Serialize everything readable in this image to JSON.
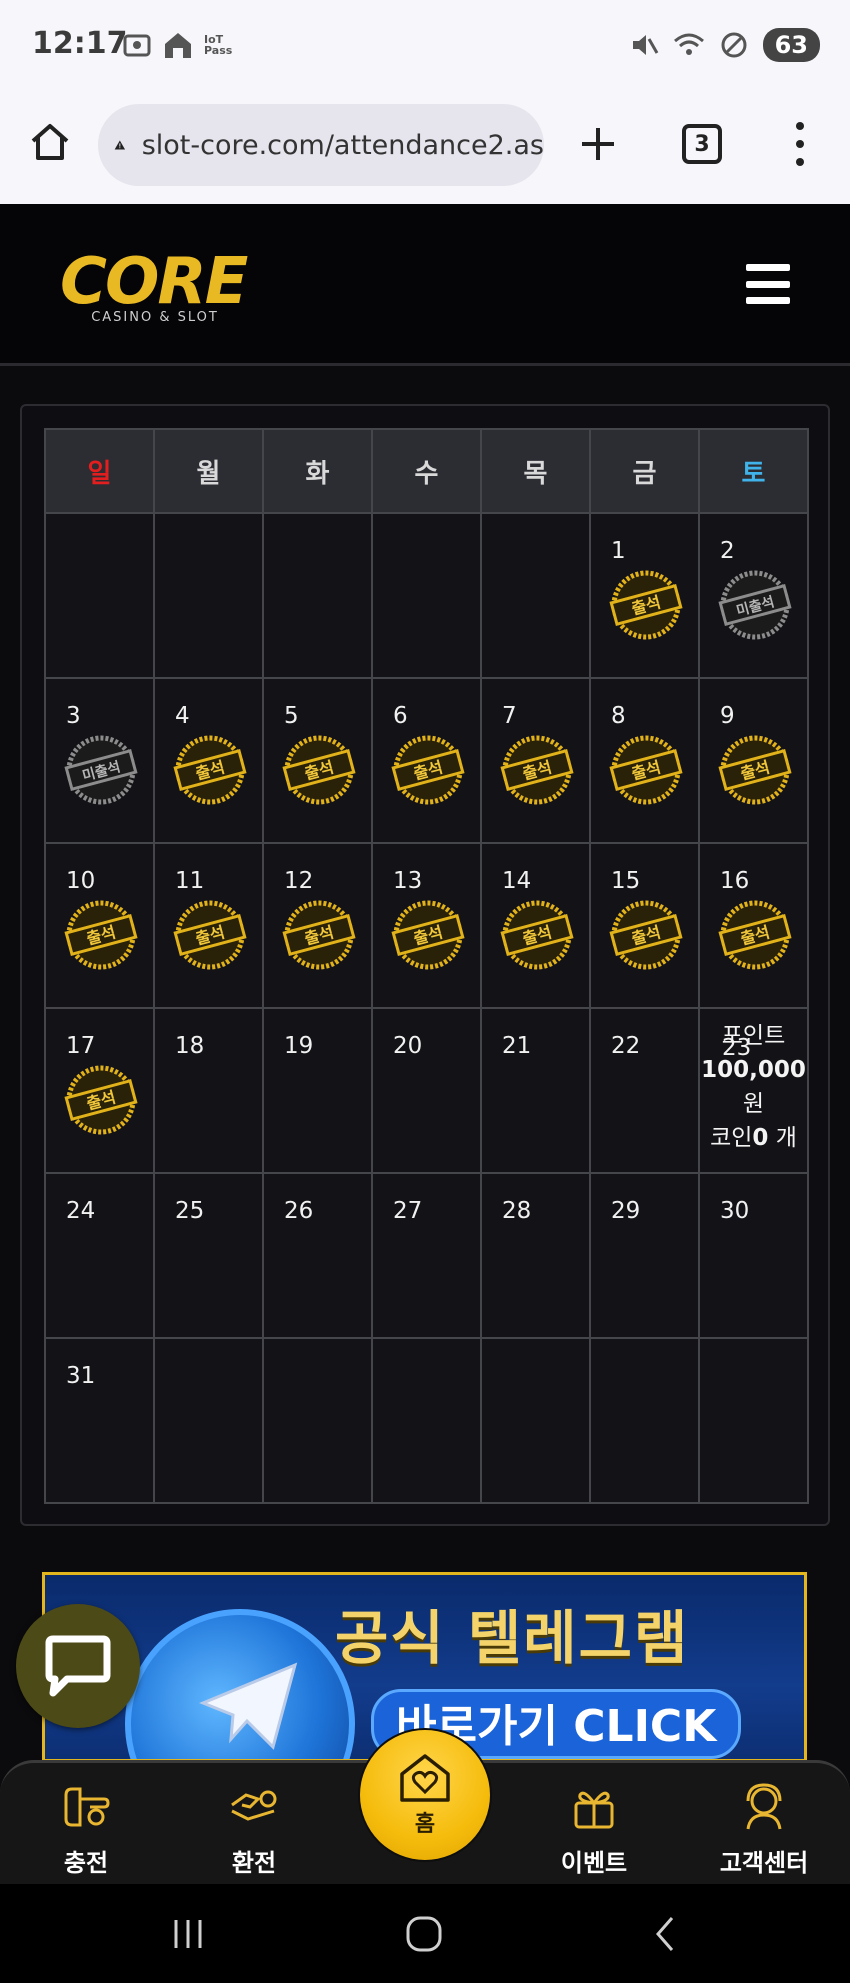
{
  "status_bar": {
    "time": "12:17",
    "iot_label": "IoT Pass",
    "battery": "63"
  },
  "browser": {
    "url": "slot-core.com/attendance2.as",
    "tab_count": "3"
  },
  "site": {
    "logo_text": "CORE",
    "logo_subtitle": "CASINO & SLOT"
  },
  "calendar": {
    "weekdays": [
      "일",
      "월",
      "화",
      "수",
      "목",
      "금",
      "토"
    ],
    "weeks": [
      [
        null,
        null,
        null,
        null,
        null,
        {
          "day": "1",
          "stamp": "attended"
        },
        {
          "day": "2",
          "stamp": "missed"
        }
      ],
      [
        {
          "day": "3",
          "stamp": "missed"
        },
        {
          "day": "4",
          "stamp": "attended"
        },
        {
          "day": "5",
          "stamp": "attended"
        },
        {
          "day": "6",
          "stamp": "attended"
        },
        {
          "day": "7",
          "stamp": "attended"
        },
        {
          "day": "8",
          "stamp": "attended"
        },
        {
          "day": "9",
          "stamp": "attended"
        }
      ],
      [
        {
          "day": "10",
          "stamp": "attended"
        },
        {
          "day": "11",
          "stamp": "attended"
        },
        {
          "day": "12",
          "stamp": "attended"
        },
        {
          "day": "13",
          "stamp": "attended"
        },
        {
          "day": "14",
          "stamp": "attended"
        },
        {
          "day": "15",
          "stamp": "attended"
        },
        {
          "day": "16",
          "stamp": "attended"
        }
      ],
      [
        {
          "day": "17",
          "stamp": "attended"
        },
        {
          "day": "18"
        },
        {
          "day": "19"
        },
        {
          "day": "20"
        },
        {
          "day": "21"
        },
        {
          "day": "22"
        },
        {
          "day": "23",
          "reward": true
        }
      ],
      [
        {
          "day": "24"
        },
        {
          "day": "25"
        },
        {
          "day": "26"
        },
        {
          "day": "27"
        },
        {
          "day": "28"
        },
        {
          "day": "29"
        },
        {
          "day": "30"
        }
      ],
      [
        {
          "day": "31"
        },
        null,
        null,
        null,
        null,
        null,
        null
      ]
    ],
    "stamp_labels": {
      "attended": "출석",
      "missed": "미출석"
    },
    "reward": {
      "points_label": "포인트",
      "points_value": "100,000",
      "currency": "원",
      "coin_prefix": "코인",
      "coin_value": "0",
      "coin_suffix": " 개"
    }
  },
  "banner": {
    "title": "공식 텔레그램",
    "subtitle": "바로가기 CLICK"
  },
  "bottom_nav": {
    "items": [
      {
        "label": "충전",
        "icon": "charge-icon"
      },
      {
        "label": "환전",
        "icon": "exchange-icon"
      },
      {
        "label": "홈",
        "icon": "home-heart-icon"
      },
      {
        "label": "이벤트",
        "icon": "gift-icon"
      },
      {
        "label": "고객센터",
        "icon": "support-icon"
      }
    ]
  },
  "colors": {
    "accent_gold": "#f5bc0c",
    "sunday_red": "#e31e1e",
    "saturday_blue": "#3fb3ea"
  }
}
